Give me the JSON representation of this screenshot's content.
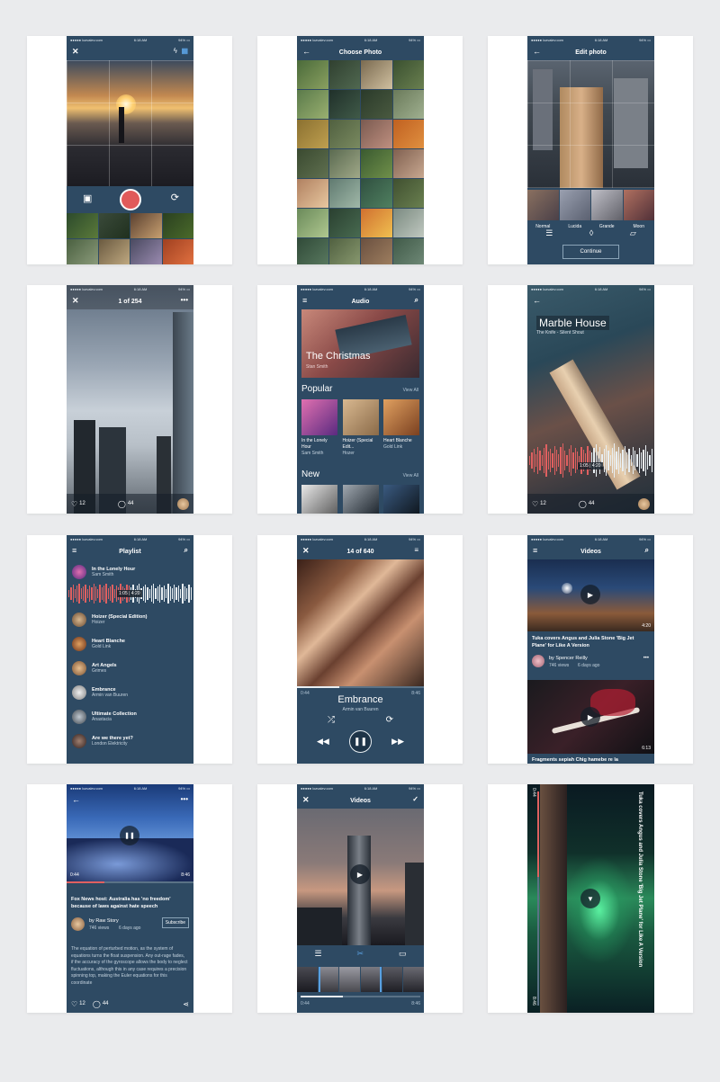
{
  "status": {
    "carrier": "●●●●● lozvalev.com",
    "time": "6:18 AM",
    "battery": "94% ▭"
  },
  "screens": {
    "camera": {},
    "choose_photo": {
      "title": "Choose Photo"
    },
    "edit_photo": {
      "title": "Edit photo",
      "filters": [
        "Normal",
        "Lucida",
        "Grande",
        "Moon"
      ],
      "continue_label": "Continue"
    },
    "viewer": {
      "counter": "1 of 254",
      "likes": "12",
      "comments": "44"
    },
    "audio": {
      "title": "Audio",
      "featured_title": "The Christmas",
      "featured_artist": "Stan Smith",
      "popular_label": "Popular",
      "new_label": "New",
      "view_all": "View All",
      "popular": [
        {
          "title": "In the Lonely Hour",
          "artist": "Sam Smith"
        },
        {
          "title": "Hoizer (Special Edit...",
          "artist": "Hozer"
        },
        {
          "title": "Heart Blanche",
          "artist": "Gold Link"
        }
      ]
    },
    "now_playing": {
      "title": "Marble House",
      "subtitle": "The Knife  -  Silent Shout",
      "time": "1:05",
      "duration": "4:20",
      "likes": "12",
      "comments": "44"
    },
    "playlist": {
      "title": "Playlist",
      "time": "1:05",
      "duration": "4:20",
      "items": [
        {
          "title": "In the Lonely Hour",
          "artist": "Sam Smith"
        },
        {
          "title": "Hoizer (Special Edition)",
          "artist": "Hoizer"
        },
        {
          "title": "Heart Blanche",
          "artist": "Gold Link"
        },
        {
          "title": "Art Angels",
          "artist": "Grimes"
        },
        {
          "title": "Embrance",
          "artist": "Armin van Buuren"
        },
        {
          "title": "Ultimate Collection",
          "artist": "Anastacia"
        },
        {
          "title": "Are we there yet?",
          "artist": "London Elektricity"
        }
      ]
    },
    "player": {
      "counter": "14 of 640",
      "elapsed": "0:44",
      "total": "8:46",
      "track": "Embrance",
      "artist": "Armin van Buuren"
    },
    "videos": {
      "title": "Videos",
      "video1_duration": "4:20",
      "video1_title": "Tuka covers Angus and Julia Stone 'Big Jet Plane' for Like A Version",
      "author": "by Spencer Reilly",
      "views": "746 views",
      "age": "6 days ago",
      "video2_duration": "6:13",
      "video2_title": "Fragments sepiah Chig hamebe re la"
    },
    "article": {
      "elapsed": "0:44",
      "total": "8:46",
      "headline": "Fox News host: Australia has 'no freedom' because of laws against hate speech",
      "author": "by Raw Story",
      "views": "746 views",
      "age": "6 days ago",
      "subscribe": "Subscribe",
      "body": "The equation of perturbed motion, as the system of equations turns the float suspension. Any out-rage fades, if the accuracy of the gyroscope allows the body to neglect fluctuations, although this in any case requires a precision spinning top, making the Euler equations for this coordinate",
      "likes": "12",
      "comments": "44"
    },
    "video_edit": {
      "title": "Videos",
      "elapsed": "0:44",
      "total": "8:46"
    },
    "landscape": {
      "caption": "Tuka covers Angus and Julia Stone 'Big Jet Plane' for Like A Version",
      "elapsed": "0:44",
      "total": "8:46"
    }
  }
}
